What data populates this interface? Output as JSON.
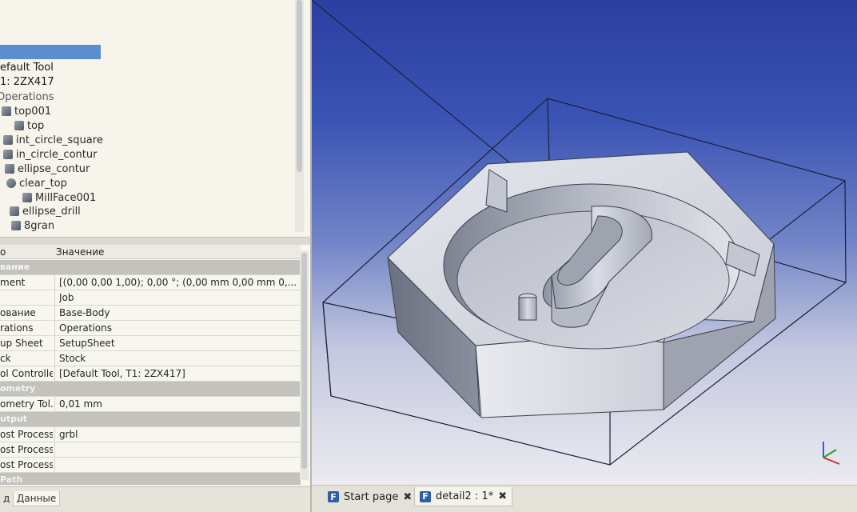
{
  "tree": {
    "items": [
      {
        "label": "efault Tool"
      },
      {
        "label": "1: 2ZX417"
      },
      {
        "label": "Operations"
      },
      {
        "label": "top001"
      },
      {
        "label": "top"
      },
      {
        "label": "int_circle_square"
      },
      {
        "label": "in_circle_contur"
      },
      {
        "label": "ellipse_contur"
      },
      {
        "label": "clear_top"
      },
      {
        "label": "MillFace001"
      },
      {
        "label": "ellipse_drill"
      },
      {
        "label": "8gran"
      }
    ]
  },
  "props": {
    "header": {
      "col1": "o",
      "col2": "Значение"
    },
    "rows": [
      {
        "key": "вание",
        "value": "",
        "group": true
      },
      {
        "key": "ment",
        "value": "[(0,00 0,00 1,00); 0,00 °; (0,00 mm  0,00 mm  0,..."
      },
      {
        "key": "",
        "value": "Job"
      },
      {
        "key": "ование",
        "value": "Base-Body"
      },
      {
        "key": "rations",
        "value": "Operations"
      },
      {
        "key": "up Sheet",
        "value": "SetupSheet"
      },
      {
        "key": "ck",
        "value": "Stock"
      },
      {
        "key": "ol Controller",
        "value": "[Default Tool, T1: 2ZX417]"
      },
      {
        "key": "ometry",
        "value": "",
        "group": true
      },
      {
        "key": "ometry Tol...",
        "value": "0,01 mm"
      },
      {
        "key": "utput",
        "value": "",
        "group": true
      },
      {
        "key": "ost Processor",
        "value": "grbl"
      },
      {
        "key": "ost Processo...",
        "value": ""
      },
      {
        "key": "ost Processo...",
        "value": ""
      },
      {
        "key": "Path",
        "value": "",
        "group": true
      }
    ]
  },
  "bottom_tabs": {
    "tab1": "д",
    "tab2": "Данные"
  },
  "doc_tabs": {
    "start_label": "Start page",
    "detail_label": "detail2 : 1*",
    "close": "✖"
  }
}
